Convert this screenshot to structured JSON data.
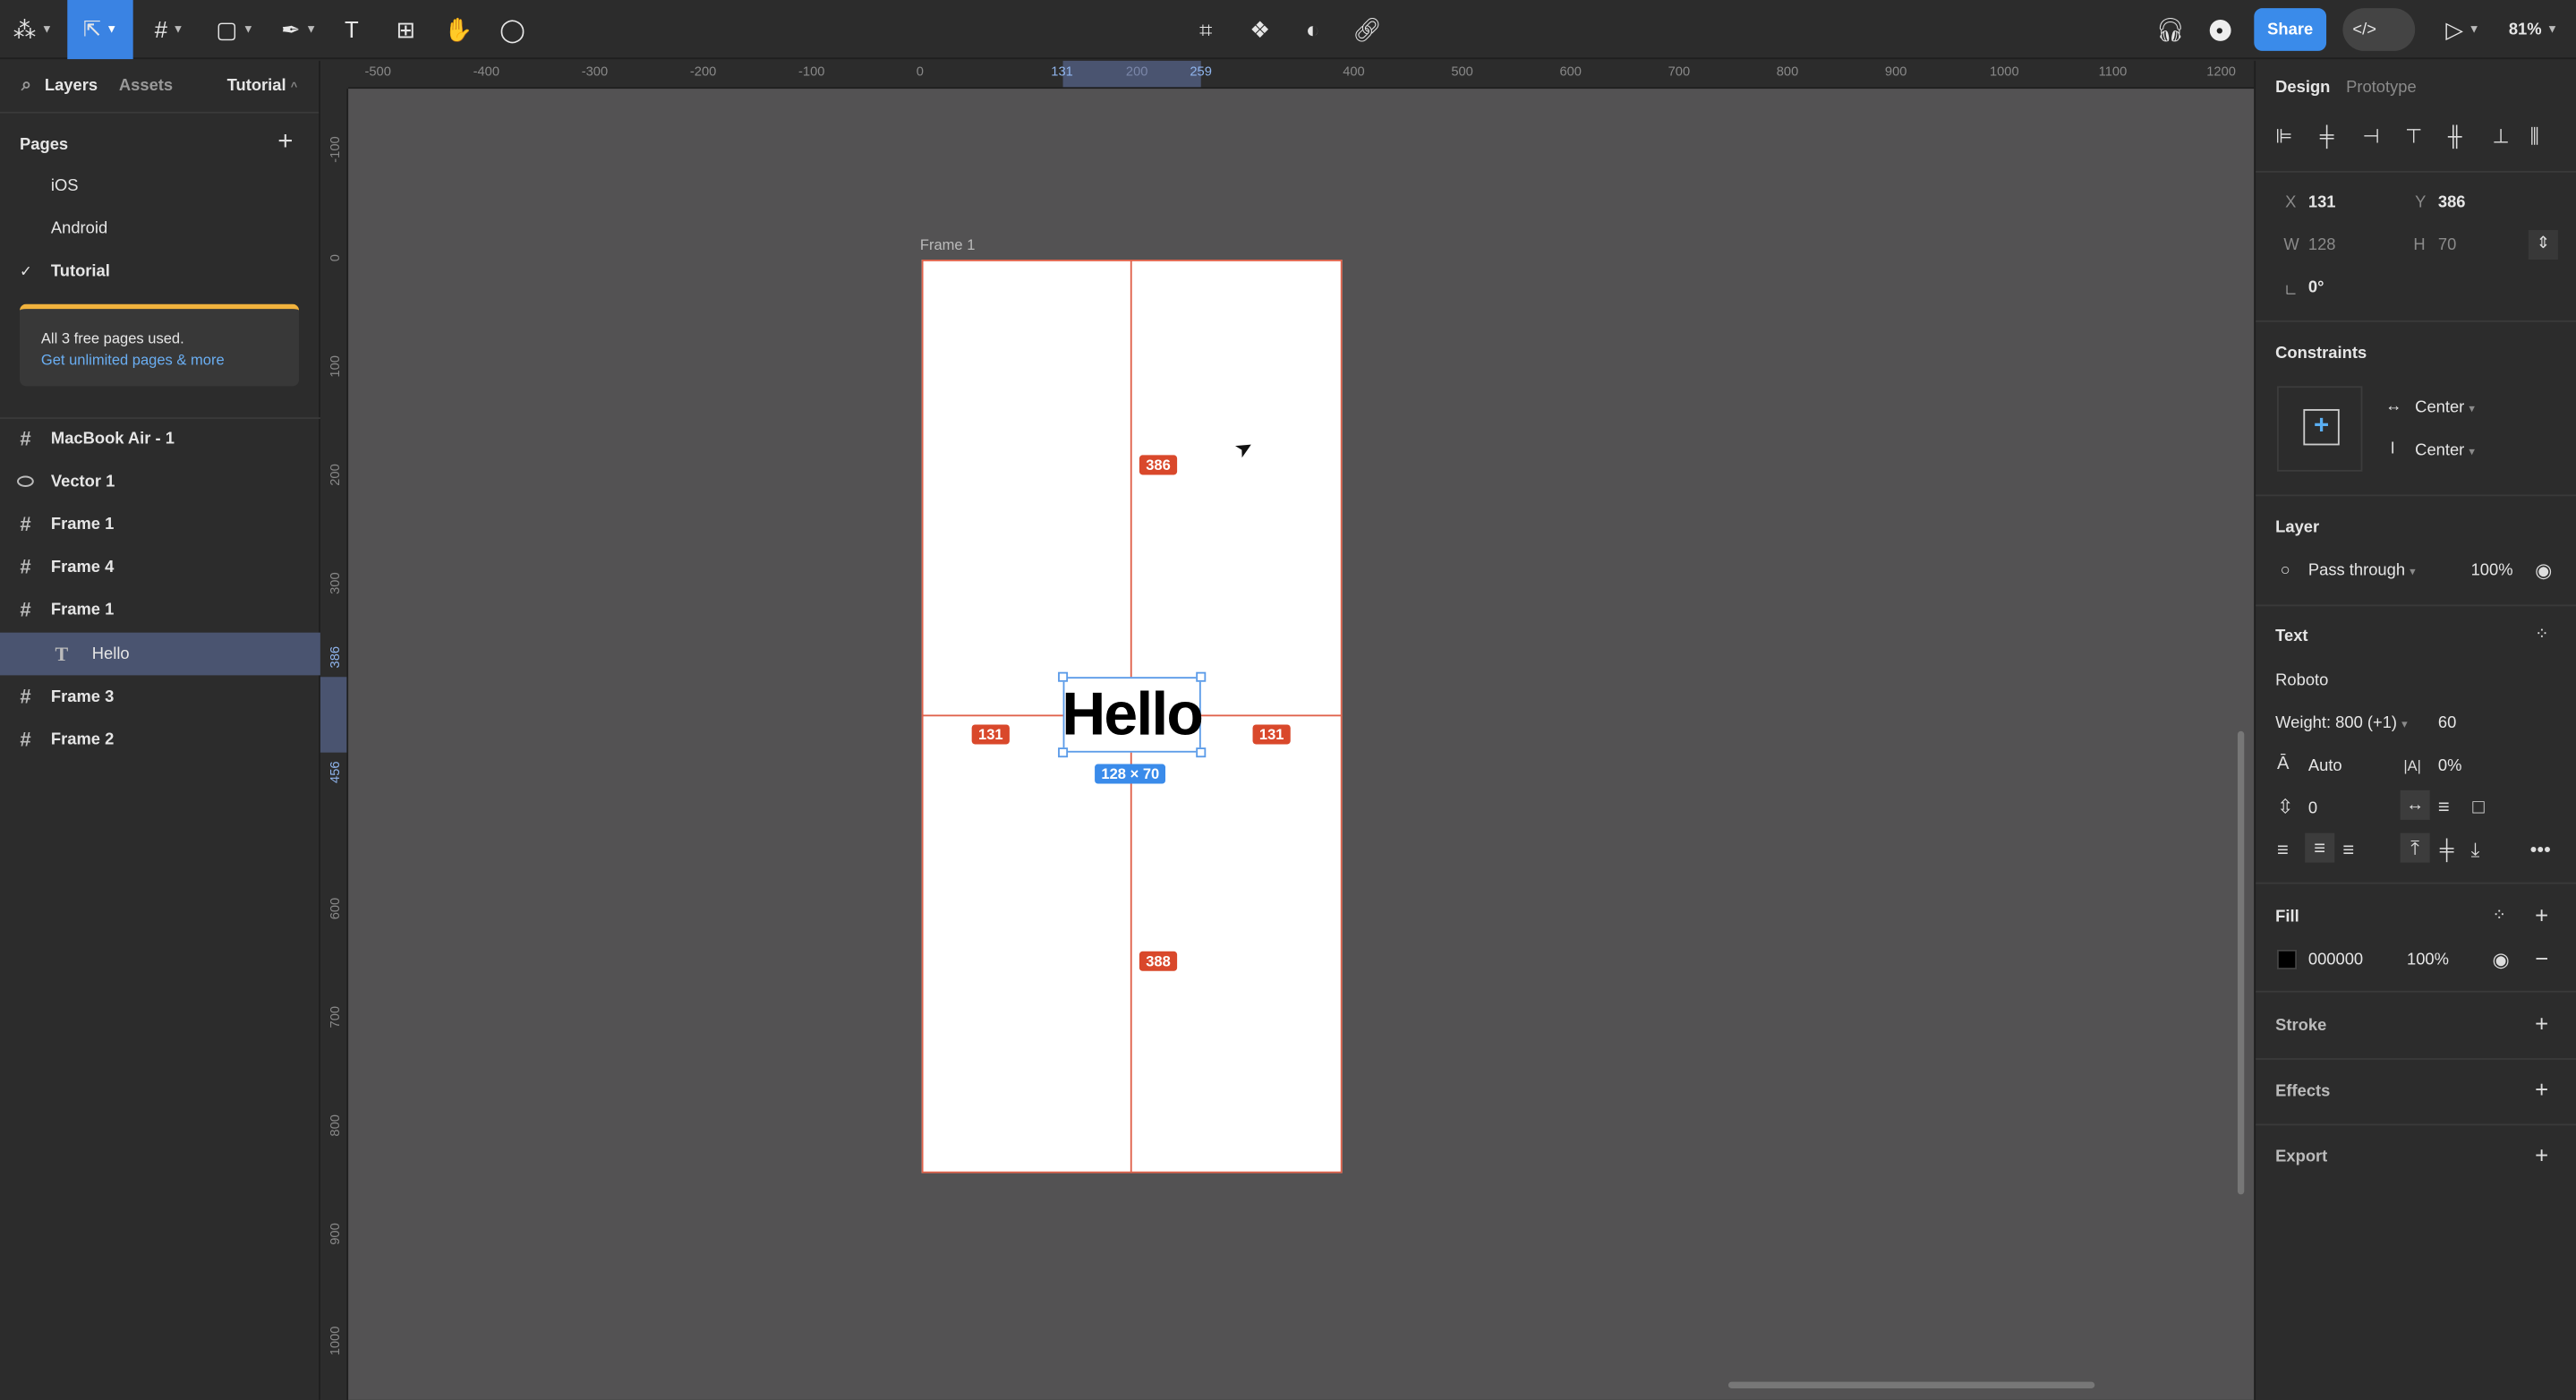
{
  "toolbar": {
    "tools": [
      {
        "name": "figma-menu-icon",
        "glyph": "⌘"
      },
      {
        "name": "move-tool-icon",
        "glyph": "➤"
      },
      {
        "name": "frame-tool-icon",
        "glyph": "#"
      },
      {
        "name": "shape-tool-icon",
        "glyph": "▢"
      },
      {
        "name": "pen-tool-icon",
        "glyph": "✒"
      },
      {
        "name": "text-tool-icon",
        "glyph": "T"
      },
      {
        "name": "resources-icon",
        "glyph": "⊞"
      },
      {
        "name": "hand-tool-icon",
        "glyph": "✋"
      },
      {
        "name": "comment-tool-icon",
        "glyph": "◯"
      }
    ],
    "center_tools": [
      "crop-icon",
      "component-icon",
      "contrast-icon",
      "link-icon"
    ],
    "share_label": "Share",
    "dev_mode_label": "</>",
    "zoom_level": "81%",
    "accent_color": "#3a8bea"
  },
  "left_panel": {
    "tabs": {
      "layers": "Layers",
      "assets": "Assets",
      "page_switcher": "Tutorial"
    },
    "pages_title": "Pages",
    "pages": [
      {
        "label": "iOS",
        "current": false
      },
      {
        "label": "Android",
        "current": false
      },
      {
        "label": "Tutorial",
        "current": true
      }
    ],
    "upgrade": {
      "text": "All 3 free pages used.",
      "link": "Get unlimited pages & more",
      "bar_color": "#f2b33d"
    },
    "layers": [
      {
        "label": "MacBook Air - 1",
        "icon": "frame-icon",
        "indent": 0
      },
      {
        "label": "Vector 1",
        "icon": "vector-icon",
        "indent": 0
      },
      {
        "label": "Frame 1",
        "icon": "frame-icon",
        "indent": 0
      },
      {
        "label": "Frame 4",
        "icon": "frame-icon",
        "indent": 0
      },
      {
        "label": "Frame 1",
        "icon": "frame-icon",
        "indent": 0
      },
      {
        "label": "Hello",
        "icon": "text-icon",
        "indent": 1,
        "selected": true
      },
      {
        "label": "Frame 3",
        "icon": "frame-icon",
        "indent": 0
      },
      {
        "label": "Frame 2",
        "icon": "frame-icon",
        "indent": 0
      }
    ]
  },
  "rulers": {
    "horizontal": [
      "-500",
      "-400",
      "-300",
      "-200",
      "-100",
      "0",
      "131",
      "200",
      "259",
      "400",
      "500",
      "600",
      "700",
      "800",
      "900",
      "1000",
      "1100",
      "1200"
    ],
    "vertical": [
      "-100",
      "0",
      "100",
      "200",
      "300",
      "386",
      "456",
      "600",
      "700",
      "800",
      "900",
      "1000"
    ]
  },
  "canvas": {
    "frame_label": "Frame 1",
    "text_content": "Hello",
    "measure_top": "386",
    "measure_left": "131",
    "measure_right": "131",
    "measure_bottom": "388",
    "size_label": "128 × 70"
  },
  "right_panel": {
    "tabs": {
      "design": "Design",
      "prototype": "Prototype"
    },
    "position": {
      "x_label": "X",
      "x": "131",
      "y_label": "Y",
      "y": "386",
      "w_label": "W",
      "w": "128",
      "h_label": "H",
      "h": "70",
      "rotation": "0°"
    },
    "constraints": {
      "title": "Constraints",
      "horizontal": "Center",
      "vertical": "Center"
    },
    "layer": {
      "title": "Layer",
      "blend": "Pass through",
      "opacity": "100%"
    },
    "text": {
      "title": "Text",
      "font": "Roboto",
      "weight": "Weight: 800 (+1)",
      "size": "60",
      "line_height": "Auto",
      "letter_spacing": "0%",
      "paragraph_spacing": "0"
    },
    "fill": {
      "title": "Fill",
      "hex": "000000",
      "opacity": "100%",
      "color": "#000000"
    },
    "stroke_title": "Stroke",
    "effects_title": "Effects",
    "export_title": "Export"
  },
  "help_label": "?"
}
